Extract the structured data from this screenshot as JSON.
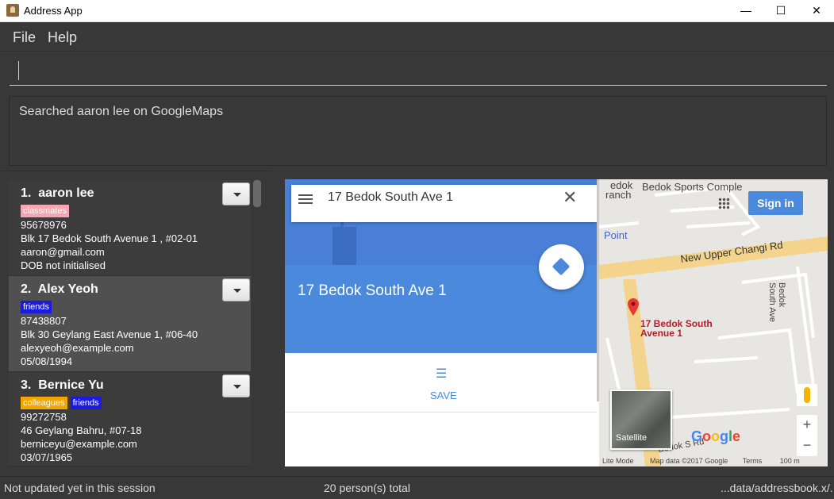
{
  "window": {
    "title": "Address App",
    "minimize": "—",
    "maximize": "☐",
    "close": "✕"
  },
  "menu": [
    {
      "label": "File"
    },
    {
      "label": "Help"
    }
  ],
  "command": {
    "value": "",
    "placeholder": ""
  },
  "result": {
    "text": "Searched aaron lee on GoogleMaps"
  },
  "persons": [
    {
      "index": "1.",
      "name": "aaron lee",
      "tags": [
        {
          "label": "classmates",
          "color": "#f4a6b3"
        }
      ],
      "phone": "95678976",
      "address": "Blk 17 Bedok South Avenue 1 , #02-01",
      "email": "aaron@gmail.com",
      "dob": "DOB not initialised",
      "selected": false
    },
    {
      "index": "2.",
      "name": "Alex Yeoh",
      "tags": [
        {
          "label": "friends",
          "color": "#1b1bdb"
        }
      ],
      "phone": "87438807",
      "address": "Blk 30 Geylang East Avenue 1, #06-40",
      "email": "alexyeoh@example.com",
      "dob": "05/08/1994",
      "selected": true
    },
    {
      "index": "3.",
      "name": "Bernice Yu",
      "tags": [
        {
          "label": "colleagues",
          "color": "#f0a500"
        },
        {
          "label": "friends",
          "color": "#1b1bdb"
        }
      ],
      "phone": "99272758",
      "address": "46 Geylang Bahru, #07-18",
      "email": "berniceyu@example.com",
      "dob": "03/07/1965",
      "selected": false
    }
  ],
  "browser": {
    "search_query": "17 Bedok South Ave 1",
    "place_title": "17 Bedok South Ave 1",
    "save_label": "SAVE",
    "sign_in": "Sign in",
    "map_labels": {
      "road1": "New Upper Changi Rd",
      "road2": "Bedok South Ave",
      "road3": "Bedok S Rd",
      "poi1": "Bedok Sports Comple",
      "poi2": "edok",
      "poi3": "ranch",
      "poi4": "Point",
      "pin_label_1": "17 Bedok South",
      "pin_label_2": "Avenue 1",
      "satellite": "Satellite",
      "google": "Google"
    },
    "footer": {
      "lite_mode": "Lite Mode",
      "map_data": "Map data ©2017 Google",
      "terms": "Terms",
      "scale": "100 m"
    },
    "colors": {
      "panel_blue": "#4a89dc",
      "road": "#f4d48c"
    }
  },
  "status": {
    "left": "Not updated yet in this session",
    "center": "20 person(s) total",
    "right": "...data/addressbook.x/."
  }
}
